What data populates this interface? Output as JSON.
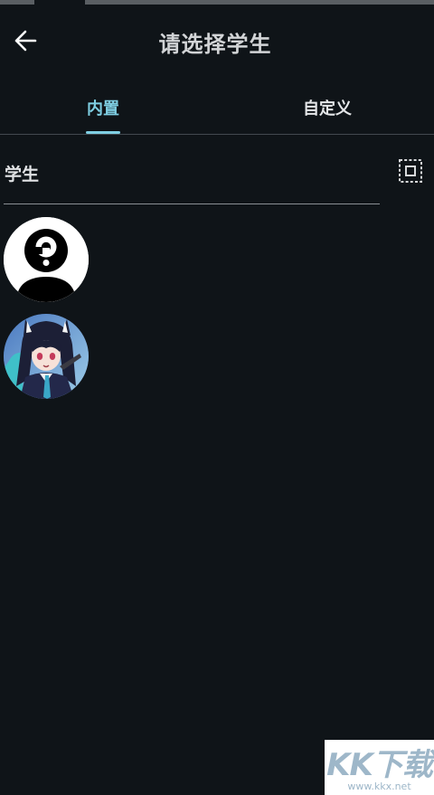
{
  "header": {
    "title": "请选择学生",
    "back_icon": "arrow-left-icon"
  },
  "tabs": [
    {
      "label": "内置",
      "active": true
    },
    {
      "label": "自定义",
      "active": false
    }
  ],
  "section": {
    "title": "学生",
    "select_all_icon": "select-all-icon"
  },
  "students": [
    {
      "avatar": "unknown-person-icon"
    },
    {
      "avatar": "anime-character-portrait"
    }
  ],
  "watermark": {
    "logo": "KK下载",
    "url": "www.kkx.net"
  },
  "colors": {
    "background": "#0f1418",
    "accent": "#7fcfe3",
    "text": "#e1e3e5"
  }
}
